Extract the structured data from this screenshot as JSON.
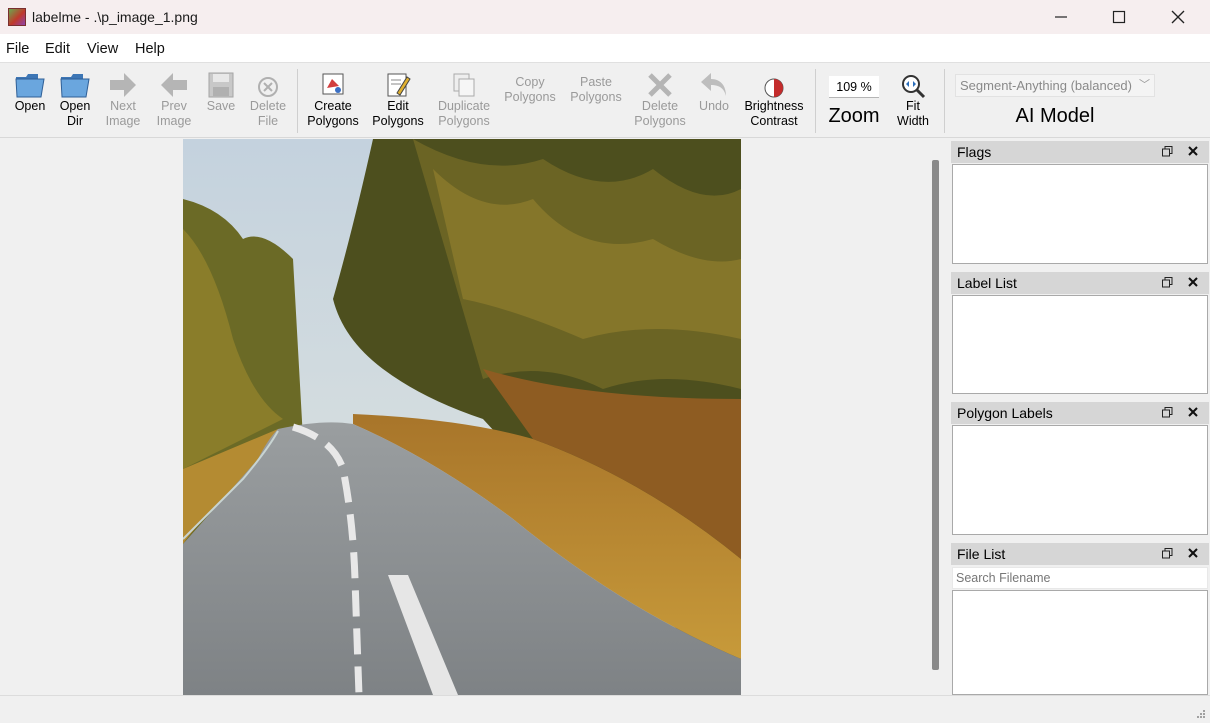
{
  "window": {
    "title": "labelme - .\\p_image_1.png"
  },
  "menu": [
    "File",
    "Edit",
    "View",
    "Help"
  ],
  "toolbar": {
    "open": "Open",
    "open_dir": "Open\nDir",
    "next_image": "Next\nImage",
    "prev_image": "Prev\nImage",
    "save": "Save",
    "delete_file": "Delete\nFile",
    "create_polygons": "Create\nPolygons",
    "edit_polygons": "Edit\nPolygons",
    "duplicate_polygons": "Duplicate\nPolygons",
    "copy_polygons": "Copy\nPolygons",
    "paste_polygons": "Paste\nPolygons",
    "delete_polygons": "Delete\nPolygons",
    "undo": "Undo",
    "brightness_contrast": "Brightness\nContrast",
    "zoom_value": "109 %",
    "zoom_label": "Zoom",
    "fit_width": "Fit\nWidth",
    "ai_model_selected": "Segment-Anything (balanced)",
    "ai_model_label": "AI Model"
  },
  "docks": {
    "flags": "Flags",
    "label_list": "Label List",
    "polygon_labels": "Polygon Labels",
    "file_list": "File List",
    "search_placeholder": "Search Filename"
  },
  "colors": {
    "titlebar_bg": "#f6eeef",
    "dock_header": "#d6d6d6",
    "disabled_text": "#9a9a9a"
  }
}
